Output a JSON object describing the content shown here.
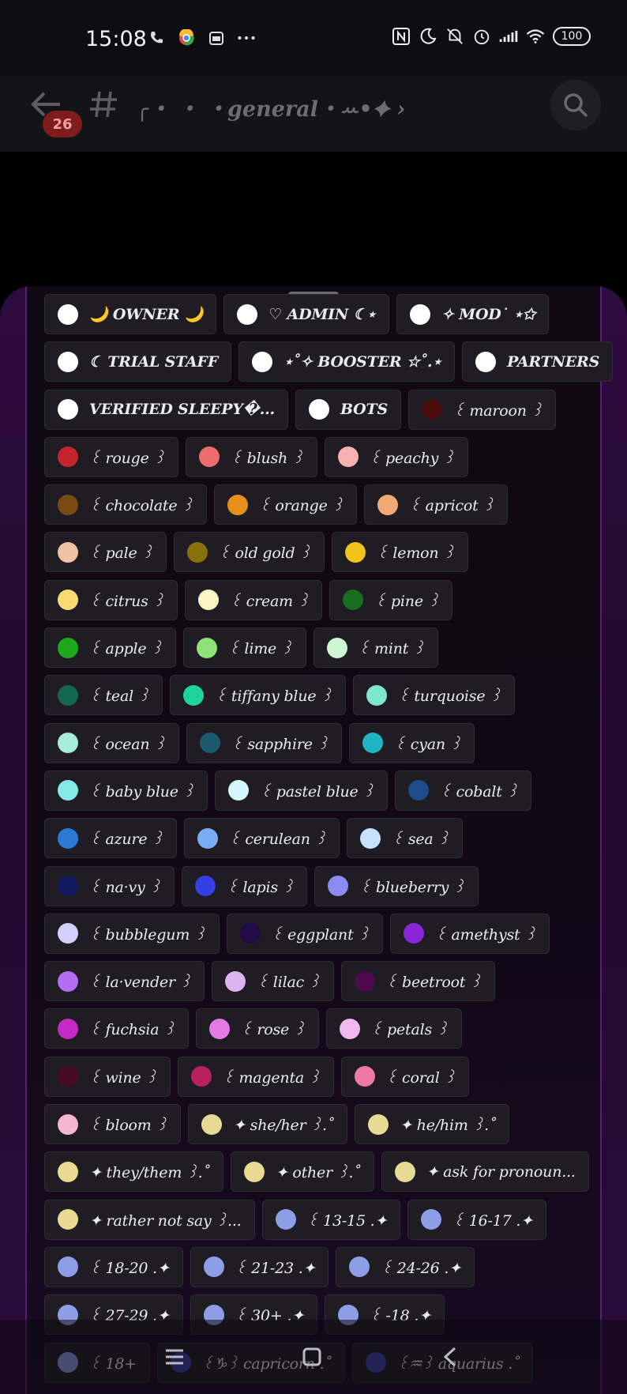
{
  "status_bar": {
    "time": "15:08",
    "battery": "100"
  },
  "header": {
    "unread_count": "26",
    "channel_name": "╭・ ・ ・general・ꕀ•✦ ›"
  },
  "roles": [
    [
      {
        "label": "🌙 OWNER 🌙",
        "color": "#ffffff",
        "bold": true
      },
      {
        "label": "♡ ADMIN ☾⋆",
        "color": "#ffffff",
        "bold": true
      },
      {
        "label": "✧ MOD˙ ⋆✩",
        "color": "#ffffff",
        "bold": true
      }
    ],
    [
      {
        "label": "☾ TRIAL STAFF",
        "color": "#ffffff",
        "bold": true
      },
      {
        "label": "⋆˚✧ BOOSTER ☆˚.⋆",
        "color": "#ffffff",
        "bold": true
      },
      {
        "label": "PARTNERS",
        "color": "#ffffff",
        "bold": true
      }
    ],
    [
      {
        "label": "VERIFIED SLEEPY�...",
        "color": "#ffffff",
        "bold": true
      },
      {
        "label": "BOTS",
        "color": "#ffffff",
        "bold": true
      },
      {
        "label": "꒰ maroon ꒱",
        "color": "#4a0b0e",
        "bold": false
      }
    ],
    [
      {
        "label": "꒰ rouge ꒱",
        "color": "#c4242c",
        "bold": false
      },
      {
        "label": "꒰ blush ꒱",
        "color": "#ee6b6e",
        "bold": false
      },
      {
        "label": "꒰ peachy ꒱",
        "color": "#f6b1b1",
        "bold": false
      }
    ],
    [
      {
        "label": "꒰ chocolate ꒱",
        "color": "#7a4a12",
        "bold": false
      },
      {
        "label": "꒰ orange ꒱",
        "color": "#e8901c",
        "bold": false
      },
      {
        "label": "꒰ apricot ꒱",
        "color": "#f2aa74",
        "bold": false
      }
    ],
    [
      {
        "label": "꒰ pale ꒱",
        "color": "#f0c1a2",
        "bold": false
      },
      {
        "label": "꒰ old gold ꒱",
        "color": "#8a6f0e",
        "bold": false
      },
      {
        "label": "꒰ lemon ꒱",
        "color": "#f2c318",
        "bold": false
      }
    ],
    [
      {
        "label": "꒰ citrus ꒱",
        "color": "#f6dc70",
        "bold": false
      },
      {
        "label": "꒰ cream ꒱",
        "color": "#fbf6c4",
        "bold": false
      },
      {
        "label": "꒰ pine ꒱",
        "color": "#186e1e",
        "bold": false
      }
    ],
    [
      {
        "label": "꒰ apple ꒱",
        "color": "#1ea81e",
        "bold": false
      },
      {
        "label": "꒰ lime ꒱",
        "color": "#8ee27a",
        "bold": false
      },
      {
        "label": "꒰ mint ꒱",
        "color": "#cff6d2",
        "bold": false
      }
    ],
    [
      {
        "label": "꒰ teal ꒱",
        "color": "#146650",
        "bold": false
      },
      {
        "label": "꒰ tiffany blue ꒱",
        "color": "#1ed29c",
        "bold": false
      },
      {
        "label": "꒰ turquoise ꒱",
        "color": "#7ee6cd",
        "bold": false
      }
    ],
    [
      {
        "label": "꒰ ocean ꒱",
        "color": "#a9ecde",
        "bold": false
      },
      {
        "label": "꒰ sapphire ꒱",
        "color": "#1a5a6c",
        "bold": false
      },
      {
        "label": "꒰ cyan ꒱",
        "color": "#1eb4c2",
        "bold": false
      }
    ],
    [
      {
        "label": "꒰ baby blue ꒱",
        "color": "#84eae8",
        "bold": false
      },
      {
        "label": "꒰ pastel blue ꒱",
        "color": "#d5f6fb",
        "bold": false
      },
      {
        "label": "꒰ cobalt ꒱",
        "color": "#1d4c8c",
        "bold": false
      }
    ],
    [
      {
        "label": "꒰ azure ꒱",
        "color": "#2b7ad6",
        "bold": false
      },
      {
        "label": "꒰ cerulean ꒱",
        "color": "#7aaef4",
        "bold": false
      },
      {
        "label": "꒰ sea ꒱",
        "color": "#c5e1fb",
        "bold": false
      }
    ],
    [
      {
        "label": "꒰ na·vy ꒱",
        "color": "#10185e",
        "bold": false
      },
      {
        "label": "꒰ lapis ꒱",
        "color": "#3540e4",
        "bold": false
      },
      {
        "label": "꒰ blueberry ꒱",
        "color": "#8a8cf2",
        "bold": false
      }
    ],
    [
      {
        "label": "꒰ bubblegum ꒱",
        "color": "#d3d0fb",
        "bold": false
      },
      {
        "label": "꒰ eggplant ꒱",
        "color": "#220a46",
        "bold": false
      },
      {
        "label": "꒰ amethyst ꒱",
        "color": "#8a26d6",
        "bold": false
      }
    ],
    [
      {
        "label": "꒰ la·vender ꒱",
        "color": "#b46cf2",
        "bold": false
      },
      {
        "label": "꒰ lilac ꒱",
        "color": "#dcb4f2",
        "bold": false
      },
      {
        "label": "꒰ beetroot ꒱",
        "color": "#4c0a4a",
        "bold": false
      }
    ],
    [
      {
        "label": "꒰ fuchsia ꒱",
        "color": "#c62ac6",
        "bold": false
      },
      {
        "label": "꒰ rose ꒱",
        "color": "#e47ae6",
        "bold": false
      },
      {
        "label": "꒰ petals ꒱",
        "color": "#f2b8f0",
        "bold": false
      }
    ],
    [
      {
        "label": "꒰ wine ꒱",
        "color": "#4a0a26",
        "bold": false
      },
      {
        "label": "꒰ magenta ꒱",
        "color": "#b8205e",
        "bold": false
      },
      {
        "label": "꒰ coral ꒱",
        "color": "#ee7aa4",
        "bold": false
      }
    ],
    [
      {
        "label": "꒰ bloom ꒱",
        "color": "#f6b6ce",
        "bold": false
      },
      {
        "label": "✦ she/her ꒱.˚",
        "color": "#e8da92",
        "bold": false
      },
      {
        "label": "✦ he/him ꒱.˚",
        "color": "#e8da92",
        "bold": false
      }
    ],
    [
      {
        "label": "✦ they/them ꒱.˚",
        "color": "#e8da92",
        "bold": false
      },
      {
        "label": "✦ other ꒱.˚",
        "color": "#e8da92",
        "bold": false
      },
      {
        "label": "✦ ask for pronoun...",
        "color": "#e8da92",
        "bold": false
      }
    ],
    [
      {
        "label": "✦ rather not say ꒱...",
        "color": "#e8da92",
        "bold": false
      },
      {
        "label": "꒰ 13-15 .✦",
        "color": "#8e9ee6",
        "bold": false
      },
      {
        "label": "꒰ 16-17 .✦",
        "color": "#8e9ee6",
        "bold": false
      }
    ],
    [
      {
        "label": "꒰ 18-20 .✦",
        "color": "#8e9ee6",
        "bold": false
      },
      {
        "label": "꒰ 21-23 .✦",
        "color": "#8e9ee6",
        "bold": false
      },
      {
        "label": "꒰ 24-26 .✦",
        "color": "#8e9ee6",
        "bold": false
      }
    ],
    [
      {
        "label": "꒰ 27-29 .✦",
        "color": "#8e9ee6",
        "bold": false
      },
      {
        "label": "꒰ 30+ .✦",
        "color": "#8e9ee6",
        "bold": false
      },
      {
        "label": "꒰ -18 .✦",
        "color": "#8e9ee6",
        "bold": false
      }
    ],
    [
      {
        "label": "꒰ 18+",
        "color": "#8e9ee6",
        "bold": false
      },
      {
        "label": "꒰♑︎꒱ capricorn .˚",
        "color": "#3a44a8",
        "bold": false
      },
      {
        "label": "꒰♒︎꒱ aquarius .˚",
        "color": "#3a44a8",
        "bold": false
      }
    ]
  ]
}
